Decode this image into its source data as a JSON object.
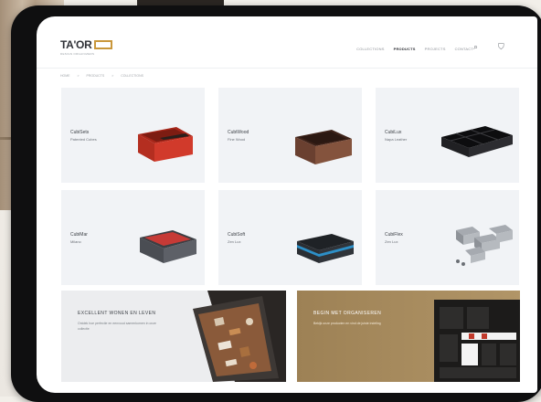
{
  "header": {
    "logo_text": "TA'OR",
    "logo_tagline": "DESIGN ORGANIZERS",
    "nav": [
      "COLLECTIONS",
      "PRODUCTS",
      "PROJECTS",
      "CONTACT"
    ],
    "active_nav_index": 1
  },
  "breadcrumb": [
    "HOME",
    "PRODUCTS",
    "COLLECTIONS"
  ],
  "products": [
    {
      "name": "CubiSets",
      "subtitle": "Patented Cubes",
      "color": "#c7372a"
    },
    {
      "name": "CubiWood",
      "subtitle": "Fine Wood",
      "color": "#6a4030"
    },
    {
      "name": "CubiLux",
      "subtitle": "Napa Leather",
      "color": "#1a1a1c"
    },
    {
      "name": "CubiMar",
      "subtitle": "Milano",
      "color": "#c63a36"
    },
    {
      "name": "CubiSoft",
      "subtitle": "Zen Lux",
      "color": "#2d8fc7"
    },
    {
      "name": "CubiFlex",
      "subtitle": "Zen Lux",
      "color": "#8e9298"
    }
  ],
  "banners": [
    {
      "title": "EXCELLENT WONEN EN LEVEN",
      "text": "Ontdek hoe perfectie en eenvoud samenkomen in onze collectie"
    },
    {
      "title": "BEGIN MET ORGANISEREN",
      "text": "Bekijk onze producten en vind de juiste indeling"
    }
  ]
}
